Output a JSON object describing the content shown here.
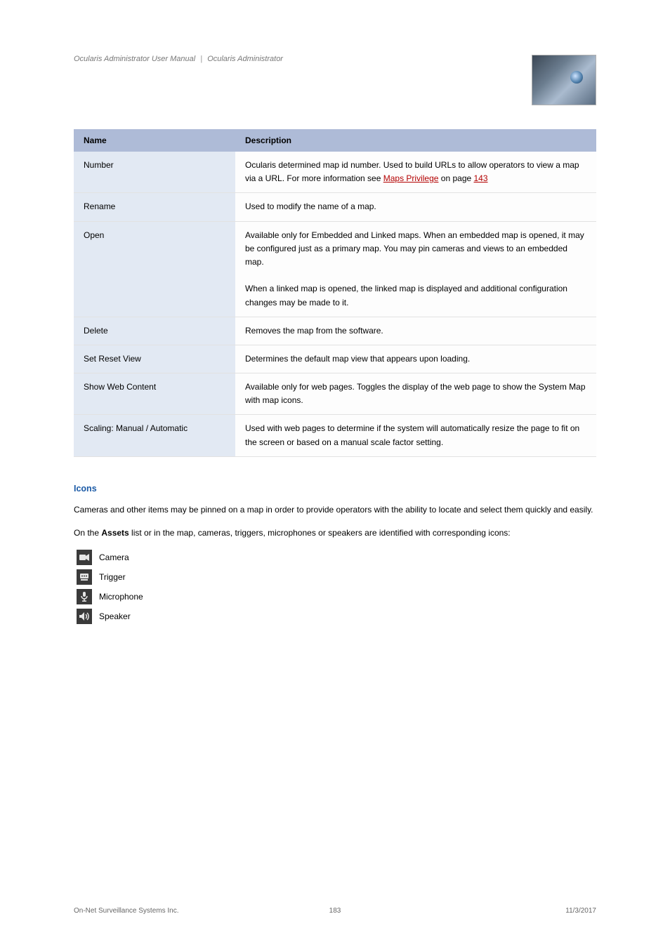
{
  "breadcrumb": {
    "parts": [
      "Ocularis Administrator User Manual",
      "Ocularis Administrator"
    ]
  },
  "logo_alt": "wolf-eye-logo",
  "table": {
    "headers": [
      "Name",
      "Description"
    ],
    "rows": [
      {
        "name": "Number",
        "desc_html": "Ocularis determined map id number. Used to build URLs to allow operators to view a map via a URL. For more information see <span class='red-link'>Maps Privilege</span> on page <span class='red-link'>143</span>"
      },
      {
        "name": "Rename",
        "desc_html": "Used to modify the name of a map."
      },
      {
        "name": "Open",
        "desc_html": "Available only for Embedded and Linked maps. When an embedded map is opened, it may be configured just as a primary map. You may pin cameras and views to an embedded map.<br><br>When a linked map is opened, the linked map is displayed and additional configuration changes may be made to it."
      },
      {
        "name": "Delete",
        "desc_html": "Removes the map from the software."
      },
      {
        "name": "Set Reset View",
        "desc_html": "Determines the default map view that appears upon loading."
      },
      {
        "name": "Show Web Content",
        "desc_html": "Available only for web pages. Toggles the display of the web page to show the System Map with map icons."
      },
      {
        "name": "Scaling: Manual / Automatic",
        "desc_html": "Used with web pages to determine if the system will automatically resize the page to fit on the screen or based on a manual scale factor setting."
      }
    ]
  },
  "section": {
    "heading": "Icons",
    "paragraphs": [
      "Cameras and other items may be pinned on a map in order to provide operators with the ability to locate and select them quickly and easily.",
      "On the <span class='bold'>Assets</span> list or in the map, cameras, triggers, microphones or speakers are identified with corresponding icons:"
    ],
    "items": [
      {
        "icon": "camera",
        "label": "Camera"
      },
      {
        "icon": "trigger",
        "label": "Trigger"
      },
      {
        "icon": "microphone",
        "label": "Microphone"
      },
      {
        "icon": "speaker",
        "label": "Speaker"
      }
    ]
  },
  "footer": {
    "left": "On-Net Surveillance Systems Inc.",
    "center": "183",
    "right": "11/3/2017"
  }
}
